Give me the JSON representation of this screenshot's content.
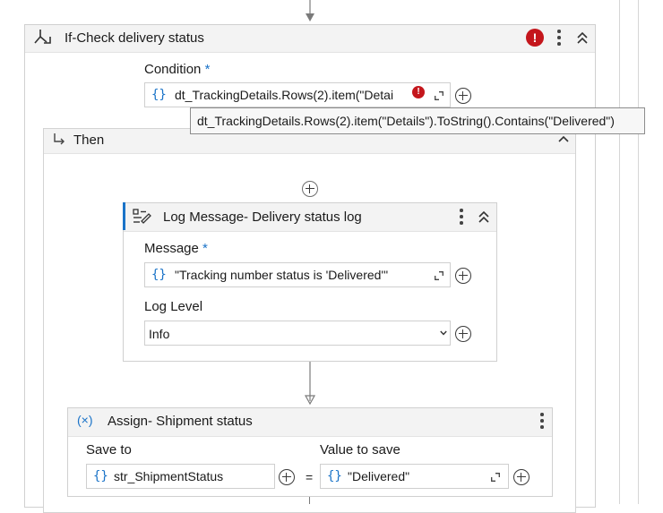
{
  "if_activity": {
    "title": "If-Check delivery status",
    "condition_label": "Condition",
    "required_mark": "*",
    "condition_value": "dt_TrackingDetails.Rows(2).item(\"Detai",
    "condition_tooltip": "dt_TrackingDetails.Rows(2).item(\"Details\").ToString().Contains(\"Delivered\")",
    "error_mark": "!",
    "then_label": "Then"
  },
  "log_message": {
    "title": "Log Message- Delivery status log",
    "message_label": "Message",
    "required_mark": "*",
    "message_value": "\"Tracking number status is 'Delivered'\"",
    "log_level_label": "Log Level",
    "log_level_value": "Info"
  },
  "assign": {
    "title": "Assign- Shipment status",
    "icon_text": "(×)",
    "save_to_label": "Save to",
    "save_to_value": "str_ShipmentStatus",
    "equals": "=",
    "value_label": "Value to save",
    "value_value": "\"Delivered\""
  },
  "expression_icon": "{}",
  "colors": {
    "accent": "#1a73c8",
    "error": "#c4161c",
    "header_bg": "#f3f3f3",
    "border": "#d0d0d0"
  },
  "icons": [
    "if-branch-icon",
    "error-icon",
    "kebab-menu-icon",
    "collapse-icon",
    "then-arrow-icon",
    "add-activity-icon",
    "log-message-icon",
    "expand-icon",
    "plus-icon",
    "chevron-down-icon",
    "assign-icon",
    "flow-arrow-icon"
  ]
}
